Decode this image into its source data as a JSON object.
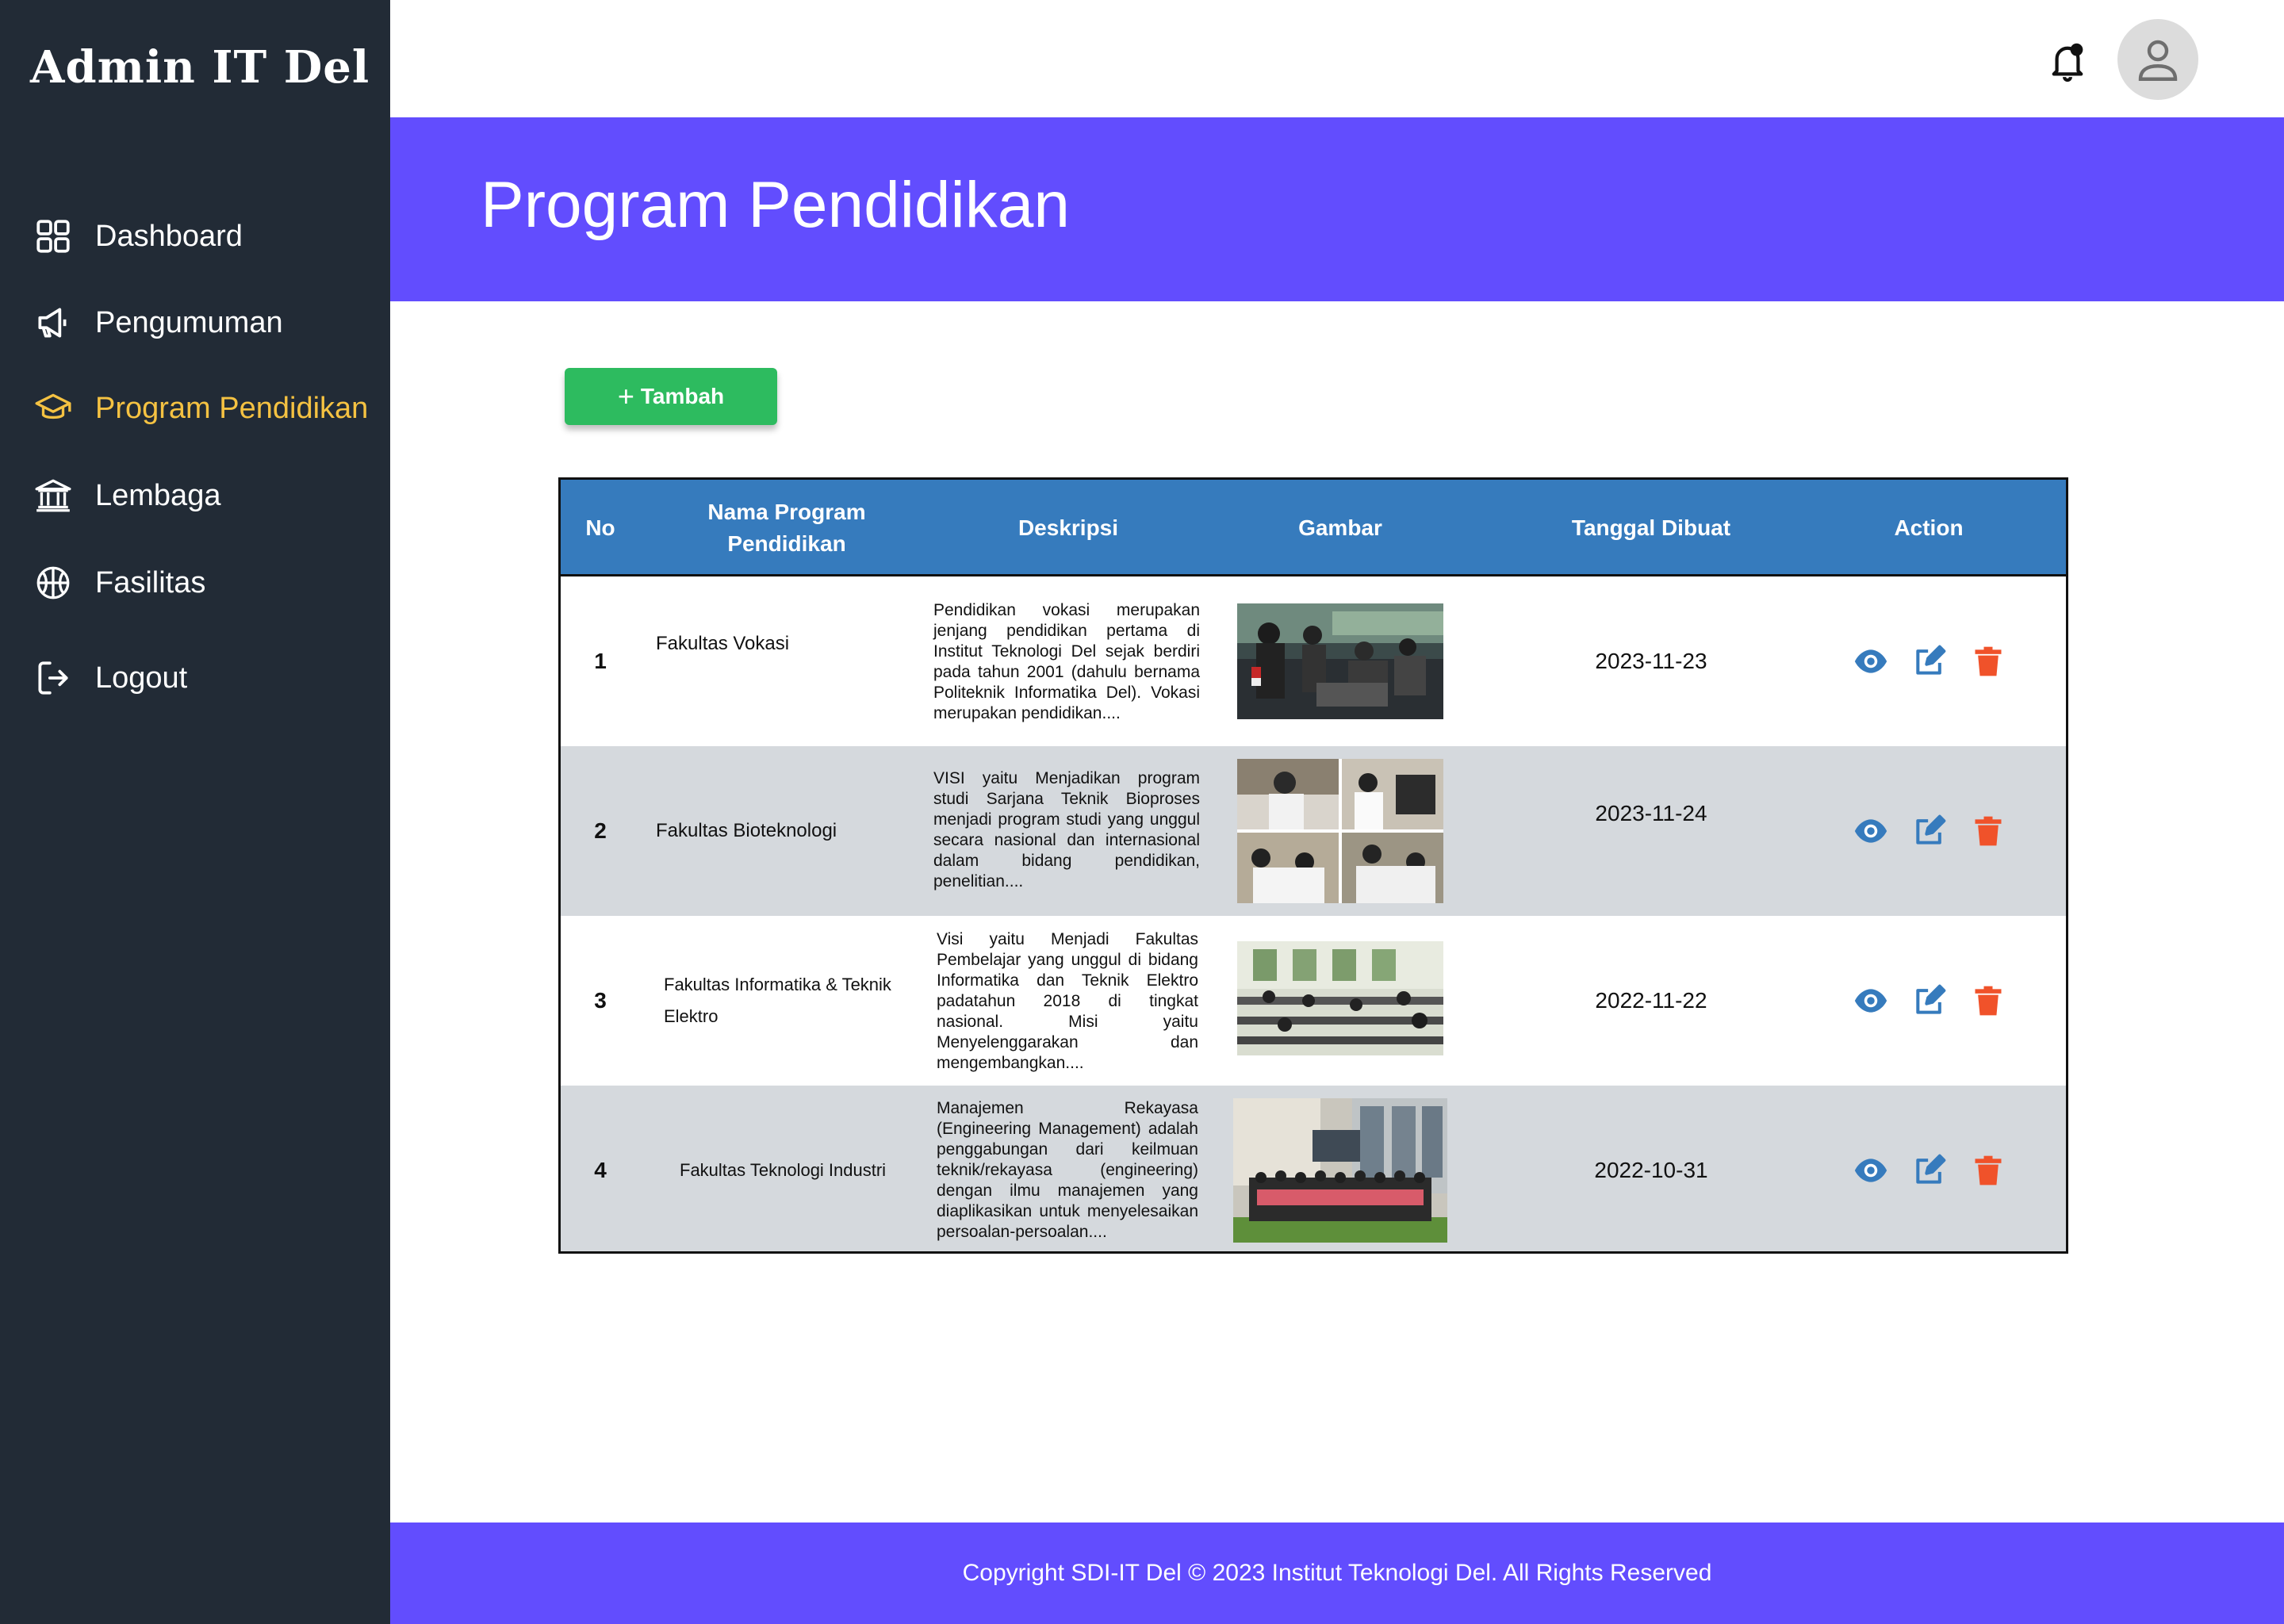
{
  "brand": "Admin IT Del",
  "sidebar": {
    "items": [
      {
        "label": "Dashboard",
        "icon": "grid-icon"
      },
      {
        "label": "Pengumuman",
        "icon": "megaphone-icon"
      },
      {
        "label": "Program Pendidikan",
        "icon": "graduation-cap-icon",
        "active": true
      },
      {
        "label": "Lembaga",
        "icon": "institution-icon"
      },
      {
        "label": "Fasilitas",
        "icon": "basketball-icon"
      },
      {
        "label": "Logout",
        "icon": "logout-icon"
      }
    ]
  },
  "header": {
    "title": "Program Pendidikan"
  },
  "toolbar": {
    "add_label": "Tambah"
  },
  "table": {
    "columns": [
      "No",
      "Nama Program Pendidikan",
      "Deskripsi",
      "Gambar",
      "Tanggal Dibuat",
      "Action"
    ],
    "rows": [
      {
        "no": "1",
        "name": "Fakultas Vokasi",
        "description": "Pendidikan vokasi merupakan jenjang pendidikan pertama di Institut Teknologi Del sejak berdiri pada tahun 2001 (dahulu bernama Politeknik Informatika Del). Vokasi merupakan pendidikan....",
        "date": "2023-11-23"
      },
      {
        "no": "2",
        "name": "Fakultas Bioteknologi",
        "description": "VISI yaitu Menjadikan program studi Sarjana Teknik Bioproses menjadi program studi yang unggul secara nasional dan internasional dalam bidang pendidikan, penelitian....",
        "date": "2023-11-24"
      },
      {
        "no": "3",
        "name": "Fakultas Informatika & Teknik Elektro",
        "description": "Visi yaitu Menjadi Fakultas Pembelajar yang unggul di bidang Informatika dan Teknik Elektro padatahun 2018 di tingkat nasional. Misi yaitu Menyelenggarakan dan mengembangkan....",
        "date": "2022-11-22"
      },
      {
        "no": "4",
        "name": "Fakultas Teknologi Industri",
        "description": "Manajemen Rekayasa (Engineering Management) adalah penggabungan dari keilmuan teknik/rekayasa (engineering) dengan ilmu manajemen yang diaplikasikan untuk menyelesaikan persoalan-persoalan....",
        "date": "2022-10-31"
      }
    ]
  },
  "footer": {
    "text": "Copyright SDI-IT Del © 2023 Institut Teknologi Del. All Rights Reserved"
  },
  "colors": {
    "sidebar": "#222b36",
    "active": "#f5c242",
    "banner": "#624dfe",
    "table_header": "#367bbd",
    "add_button": "#2dbb5f",
    "view_icon": "#367bbd",
    "edit_icon": "#367bbd",
    "delete_icon": "#f0522a"
  }
}
